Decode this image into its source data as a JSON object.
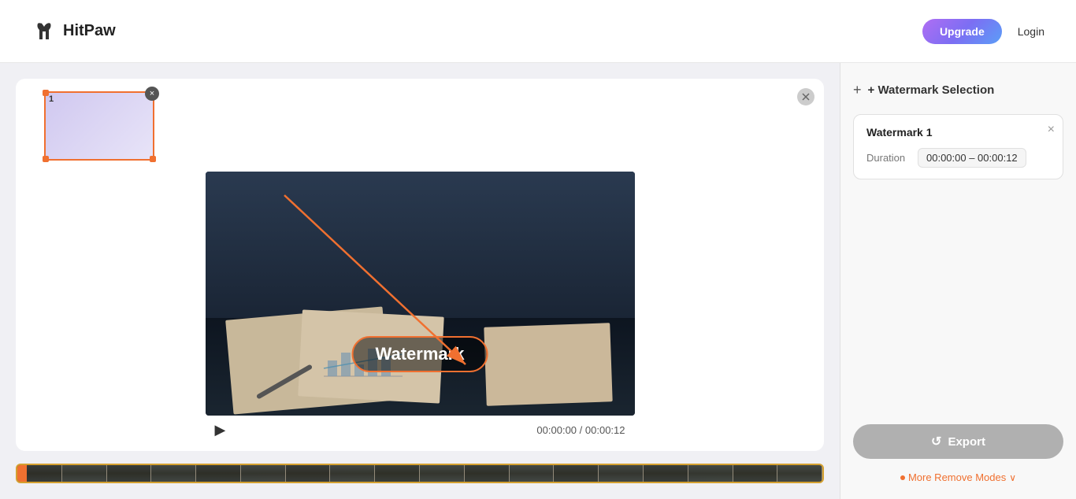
{
  "header": {
    "logo_text": "HitPaw",
    "upgrade_label": "Upgrade",
    "login_label": "Login"
  },
  "toolbar": {
    "add_watermark_label": "+ Watermark Selection"
  },
  "watermark_card": {
    "title": "Watermark 1",
    "duration_label": "Duration",
    "duration_value": "00:00:00 – 00:00:12",
    "close_icon": "×"
  },
  "video": {
    "watermark_text": "Watermark",
    "time_current": "00:00:00",
    "time_total": "00:00:12",
    "time_separator": " / ",
    "thumb_number": "1"
  },
  "export": {
    "label": "Export",
    "icon": "↺"
  },
  "more_modes": {
    "label": "More Remove Modes"
  }
}
